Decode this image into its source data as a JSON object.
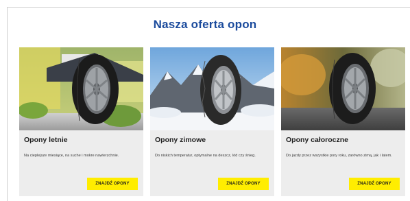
{
  "section_title": "Nasza oferta opon",
  "cards": [
    {
      "title": "Opony letnie",
      "description": "Na cieplejsze miesiące, na suche i mokre nawierzchnie.",
      "button_label": "ZNAJDŹ OPONY",
      "image": "summer-tire-image"
    },
    {
      "title": "Opony zimowe",
      "description": "Do niskich temperatur, optymalne na deszcz, lód czy śnieg.",
      "button_label": "ZNAJDŹ OPONY",
      "image": "winter-tire-image"
    },
    {
      "title": "Opony całoroczne",
      "description": "Do jazdy przez wszystkie pory roku, zarówno zimą, jak i latem.",
      "button_label": "ZNAJDŹ OPONY",
      "image": "all-season-tire-image"
    }
  ],
  "colors": {
    "title": "#1a4a9c",
    "card_background": "#ededed",
    "button": "#ffed00"
  }
}
